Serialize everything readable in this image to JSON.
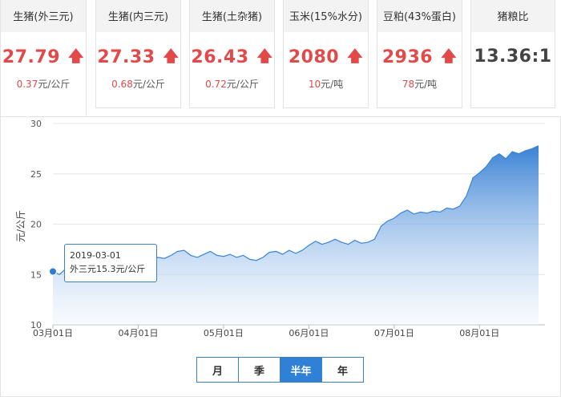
{
  "cards": [
    {
      "title": "生猪(外三元)",
      "value": "27.79",
      "change": "0.37",
      "unit": "元/公斤",
      "trend": "up"
    },
    {
      "title": "生猪(内三元)",
      "value": "27.33",
      "change": "0.68",
      "unit": "元/公斤",
      "trend": "up"
    },
    {
      "title": "生猪(土杂猪)",
      "value": "26.43",
      "change": "0.72",
      "unit": "元/公斤",
      "trend": "up"
    },
    {
      "title": "玉米(15%水分)",
      "value": "2080",
      "change": "10",
      "unit": "元/吨",
      "trend": "up"
    },
    {
      "title": "豆粕(43%蛋白)",
      "value": "2936",
      "change": "78",
      "unit": "元/吨",
      "trend": "up"
    },
    {
      "title": "猪粮比",
      "value": "13.36:1"
    }
  ],
  "arrow_glyph": "🡅",
  "chart_data": {
    "type": "area",
    "ylabel": "元/公斤",
    "ylim": [
      10,
      30
    ],
    "yticks": [
      "10",
      "15",
      "20",
      "25",
      "30"
    ],
    "xticks": [
      "03月01日",
      "04月01日",
      "05月01日",
      "06月01日",
      "07月01日",
      "08月01日"
    ],
    "x_start": "2019-03-01",
    "series": [
      {
        "values": [
          15.3,
          15.0,
          15.6,
          16.2,
          16.8,
          17.2,
          17.4,
          17.1,
          16.9,
          17.3,
          17.5,
          17.2,
          16.6,
          16.4,
          16.7,
          16.3,
          16.7,
          16.6,
          16.9,
          17.3,
          17.4,
          16.9,
          16.7,
          17.0,
          17.3,
          16.9,
          16.8,
          17.0,
          16.7,
          16.9,
          16.5,
          16.4,
          16.7,
          17.2,
          17.3,
          17.0,
          17.4,
          17.1,
          17.4,
          17.9,
          18.3,
          18.0,
          18.2,
          18.5,
          18.2,
          18.0,
          18.4,
          18.1,
          18.2,
          18.5,
          19.8,
          20.3,
          20.6,
          21.1,
          21.4,
          21.0,
          21.2,
          21.1,
          21.3,
          21.2,
          21.6,
          21.5,
          21.8,
          22.8,
          24.6,
          25.1,
          25.7,
          26.6,
          27.0,
          26.5,
          27.2,
          27.0,
          27.3,
          27.5,
          27.79
        ]
      }
    ]
  },
  "tooltip": {
    "date": "2019-03-01",
    "label": "外三元15.3元/公斤"
  },
  "periods": [
    {
      "label": "月",
      "active": false
    },
    {
      "label": "季",
      "active": false
    },
    {
      "label": "半年",
      "active": true
    },
    {
      "label": "年",
      "active": false
    }
  ],
  "colors": {
    "up": "#e24a4a",
    "accent": "#2f80d6",
    "area_top": "#2f7bd2",
    "area_bottom": "#eaf2fc"
  }
}
